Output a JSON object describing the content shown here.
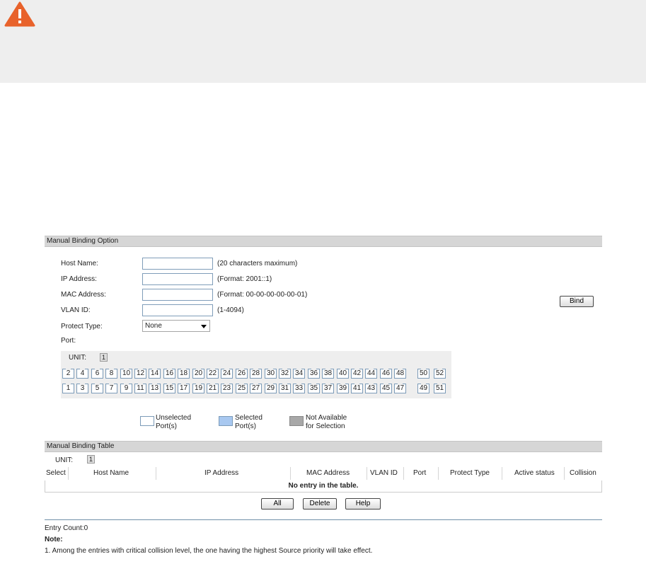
{
  "manual_binding_option": {
    "title": "Manual Binding Option",
    "fields": {
      "host_name": {
        "label": "Host Name:",
        "value": "",
        "hint": "(20 characters maximum)"
      },
      "ip_address": {
        "label": "IP Address:",
        "value": "",
        "hint": "(Format: 2001::1)"
      },
      "mac_address": {
        "label": "MAC Address:",
        "value": "",
        "hint": "(Format: 00-00-00-00-00-01)"
      },
      "vlan_id": {
        "label": "VLAN ID:",
        "value": "",
        "hint": "(1-4094)"
      },
      "protect_type": {
        "label": "Protect Type:",
        "value": "None"
      },
      "port": {
        "label": "Port:"
      }
    },
    "bind_label": "Bind",
    "unit_label": "UNIT:",
    "unit_value": "1",
    "ports_top": [
      "2",
      "4",
      "6",
      "8",
      "10",
      "12",
      "14",
      "16",
      "18",
      "20",
      "22",
      "24",
      "26",
      "28",
      "30",
      "32",
      "34",
      "36",
      "38",
      "40",
      "42",
      "44",
      "46",
      "48"
    ],
    "ports_bottom": [
      "1",
      "3",
      "5",
      "7",
      "9",
      "11",
      "13",
      "15",
      "17",
      "19",
      "21",
      "23",
      "25",
      "27",
      "29",
      "31",
      "33",
      "35",
      "37",
      "39",
      "41",
      "43",
      "45",
      "47"
    ],
    "sfp_top": [
      "50",
      "52"
    ],
    "sfp_bottom": [
      "49",
      "51"
    ],
    "legend": {
      "unselected_1": "Unselected",
      "unselected_2": "Port(s)",
      "selected_1": "Selected",
      "selected_2": "Port(s)",
      "na_1": "Not Available",
      "na_2": "for Selection",
      "colors": {
        "unselected": "#ffffff",
        "selected": "#a8c8f0",
        "not_available": "#a8a8a8"
      }
    }
  },
  "manual_binding_table": {
    "title": "Manual Binding Table",
    "unit_label": "UNIT:",
    "unit_value": "1",
    "columns": [
      "Select",
      "Host Name",
      "IP Address",
      "MAC Address",
      "VLAN ID",
      "Port",
      "Protect Type",
      "Active status",
      "Collision"
    ],
    "empty_message": "No entry in the table.",
    "buttons": {
      "all": "All",
      "delete": "Delete",
      "help": "Help"
    }
  },
  "footer": {
    "entry_count": "Entry Count:0",
    "note_label": "Note:",
    "note_1": "1. Among the entries with critical collision level, the one having the highest Source priority will take effect."
  },
  "colors": {
    "warning": "#e8622b",
    "section_bar": "#d6d6d6",
    "banner": "#eeeeee"
  }
}
